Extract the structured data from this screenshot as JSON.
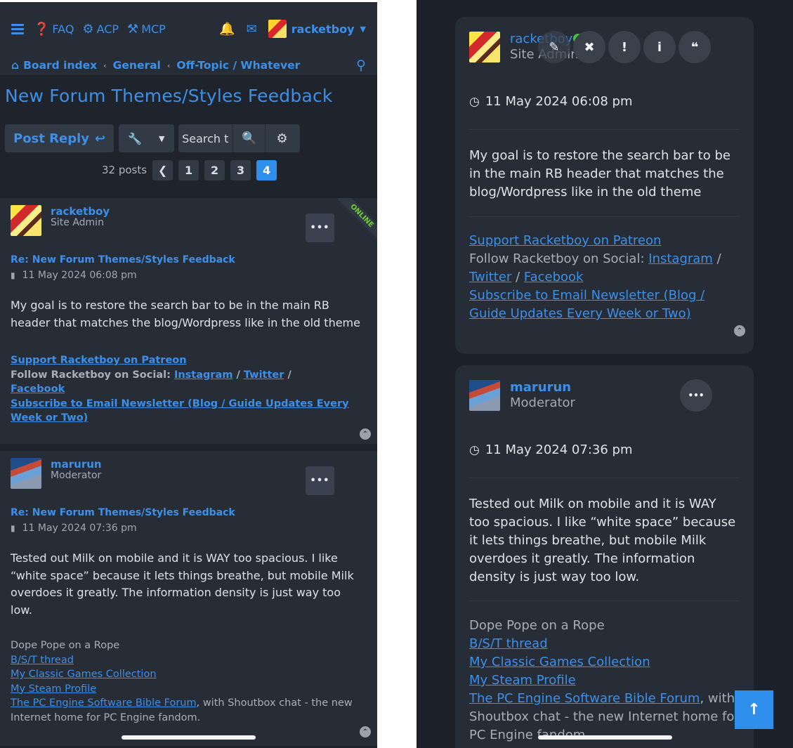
{
  "left": {
    "nav": {
      "faq": "FAQ",
      "acp": "ACP",
      "mcp": "MCP",
      "username": "racketboy"
    },
    "breadcrumb": {
      "home": "Board index",
      "general": "General",
      "forum": "Off-Topic / Whatever"
    },
    "topic_title": "New Forum Themes/Styles Feedback",
    "actions": {
      "post_reply": "Post Reply",
      "search_value": "Search t"
    },
    "pagination": {
      "count": "32 posts",
      "pages": [
        "1",
        "2",
        "3",
        "4"
      ],
      "current": "4"
    },
    "posts": [
      {
        "username": "racketboy",
        "rank": "Site Admin",
        "online_label": "ONLINE",
        "subject": "Re: New Forum Themes/Styles Feedback",
        "date": "11 May 2024 06:08 pm",
        "body": "My goal is to restore the search bar to be in the main RB header that matches the blog/Wordpress like in the old theme",
        "sig": {
          "patreon": "Support Racketboy on Patreon",
          "follow": "Follow Racketboy on Social:",
          "instagram": "Instagram",
          "slash": "/",
          "twitter": "Twitter",
          "facebook": "Facebook",
          "newsletter": "Subscribe to Email Newsletter (Blog / Guide Updates Every Week or Two)"
        }
      },
      {
        "username": "marurun",
        "rank": "Moderator",
        "subject": "Re: New Forum Themes/Styles Feedback",
        "date": "11 May 2024 07:36 pm",
        "body": "Tested out Milk on mobile and it is WAY too spacious. I like “white space” because it lets things breathe, but mobile Milk overdoes it greatly. The information density is just way too low.",
        "sig": {
          "line1": "Dope Pope on a Rope",
          "bst": "B/S/T thread",
          "classic": "My Classic Games Collection",
          "steam": "My Steam Profile",
          "pce": "The PC Engine Software Bible Forum",
          "pce_rest": ", with Shoutbox chat - the new Internet home for PC Engine fandom."
        }
      }
    ]
  },
  "right": {
    "posts": [
      {
        "username": "racketboy",
        "rank": "Site Admin",
        "date": "11 May 2024 06:08 pm",
        "body": "My goal is to restore the search bar to be in the main RB header that matches the blog/Wordpress like in the old theme",
        "sig": {
          "patreon": "Support Racketboy on Patreon",
          "follow": "Follow Racketboy on Social:",
          "instagram": "Instagram",
          "slash": "/",
          "twitter": "Twitter",
          "facebook": "Facebook",
          "newsletter": "Subscribe to Email Newsletter (Blog / Guide Updates Every Week or Two)"
        }
      },
      {
        "username": "marurun",
        "rank": "Moderator",
        "date": "11 May 2024 07:36 pm",
        "body": "Tested out Milk on mobile and it is WAY too spacious. I like “white space” because it lets things breathe, but mobile Milk overdoes it greatly. The information density is just way too low.",
        "sig": {
          "line1": "Dope Pope on a Rope",
          "bst": "B/S/T thread",
          "classic": "My Classic Games Collection",
          "steam": "My Steam Profile",
          "pce": "The PC Engine Software Bible Forum",
          "pce_rest": ", with Shoutbox chat - the new Internet home for PC Engine fandom."
        }
      }
    ]
  },
  "colors": {
    "accent": "#3d8fe8",
    "bg": "#1f242c",
    "panel": "#272d37",
    "online": "#46c23b",
    "active_page": "#2f8fec"
  }
}
